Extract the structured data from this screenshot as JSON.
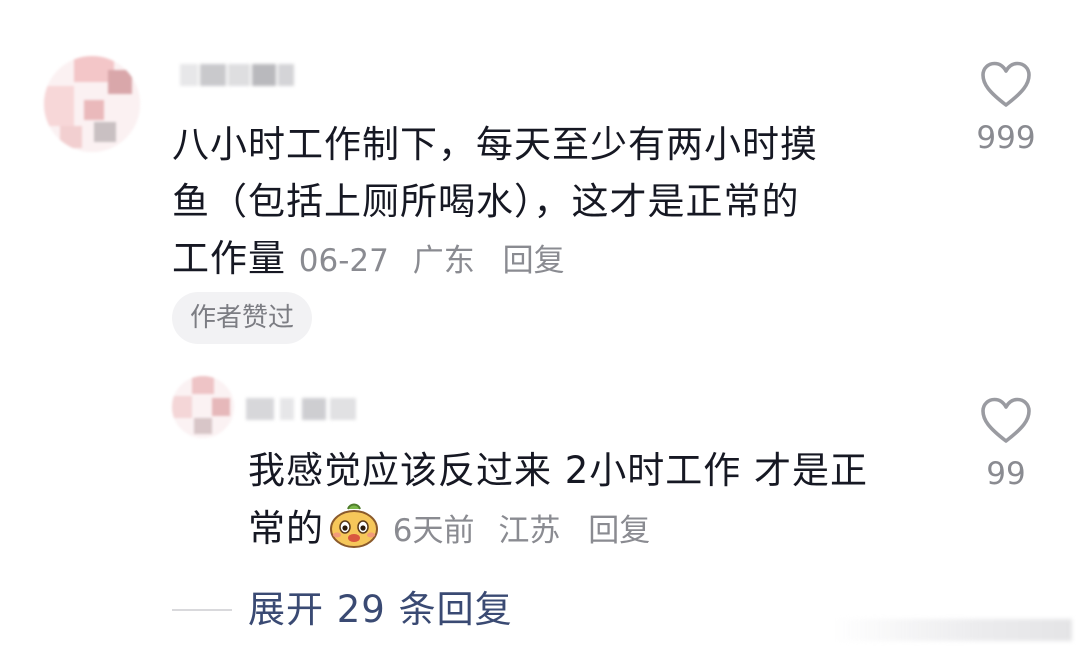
{
  "comments": [
    {
      "text_lines": [
        "八小时工作制下，每天至少有两小时摸",
        "鱼（包括上厕所喝水），这才是正常的",
        "工作量"
      ],
      "date": "06-27",
      "region": "广东",
      "reply_label": "回复",
      "badge": "作者赞过",
      "likes": "999"
    },
    {
      "text_lines": [
        "我感觉应该反过来 2小时工作 才是正",
        "常的"
      ],
      "date": "6天前",
      "region": "江苏",
      "reply_label": "回复",
      "likes": "99"
    }
  ],
  "expand": {
    "label": "展开 29 条回复"
  },
  "colors": {
    "text": "#161823",
    "meta": "#8a8b91",
    "expand_link": "#3a4a73",
    "badge_bg": "#f2f2f4"
  }
}
